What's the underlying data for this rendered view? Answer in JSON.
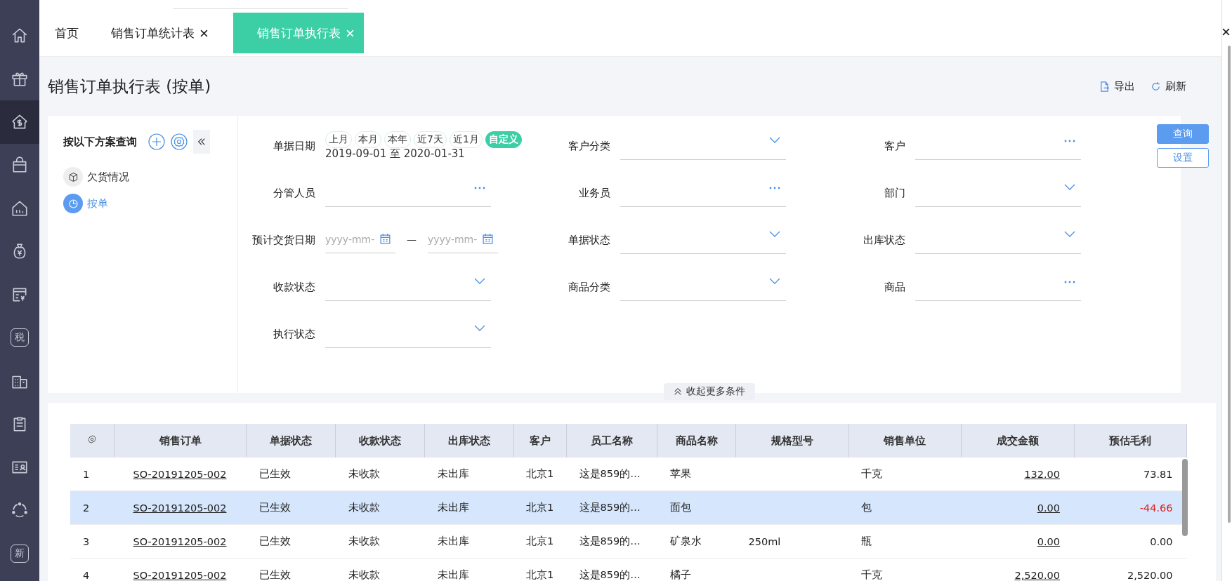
{
  "sidebar": {
    "items": [
      {
        "selected": false
      },
      {
        "selected": false
      },
      {
        "selected": true
      },
      {
        "selected": false
      },
      {
        "selected": false
      },
      {
        "selected": false
      },
      {
        "selected": false
      },
      {
        "glyph": "税",
        "selected": false
      },
      {
        "selected": false
      },
      {
        "selected": false
      },
      {
        "selected": false
      },
      {
        "selected": false
      },
      {
        "glyph": "新",
        "selected": false
      }
    ]
  },
  "tabs": [
    {
      "label": "首页",
      "closable": false,
      "selected": false
    },
    {
      "label": "销售订单统计表",
      "closable": true,
      "selected": false
    },
    {
      "label": "销售订单执行表",
      "closable": true,
      "selected": true
    }
  ],
  "page": {
    "title": "销售订单执行表 (按单)",
    "actions": [
      {
        "kind": "export",
        "label": "导出"
      },
      {
        "kind": "refresh",
        "label": "刷新"
      }
    ]
  },
  "schemes_panel": {
    "title": "按以下方案查询",
    "schemes": [
      {
        "label": "欠货情况",
        "selected": false
      },
      {
        "label": "按单",
        "selected": true
      }
    ]
  },
  "filters": [
    {
      "label": "单据日期",
      "kind": "date_presets",
      "presets": [
        {
          "label": "上月",
          "selected": false
        },
        {
          "label": "本月",
          "selected": false
        },
        {
          "label": "本年",
          "selected": false
        },
        {
          "label": "近7天",
          "selected": false
        },
        {
          "label": "近1月",
          "selected": false
        },
        {
          "label": "自定义",
          "selected": true
        }
      ],
      "range": "2019-09-01 至 2020-01-31"
    },
    {
      "label": "客户分类",
      "kind": "dropdown"
    },
    {
      "label": "客户",
      "kind": "picker"
    },
    {
      "label": "分管人员",
      "kind": "picker"
    },
    {
      "label": "业务员",
      "kind": "picker"
    },
    {
      "label": "部门",
      "kind": "dropdown"
    },
    {
      "label": "预计交货日期",
      "kind": "date_range",
      "from_placeholder": "yyyy-mm-",
      "separator": "—",
      "to_placeholder": "yyyy-mm-"
    },
    {
      "label": "单据状态",
      "kind": "dropdown"
    },
    {
      "label": "出库状态",
      "kind": "dropdown"
    },
    {
      "label": "收款状态",
      "kind": "dropdown"
    },
    {
      "label": "商品分类",
      "kind": "dropdown"
    },
    {
      "label": "商品",
      "kind": "picker"
    },
    {
      "label": "执行状态",
      "kind": "dropdown"
    }
  ],
  "buttons": [
    {
      "label": "查询",
      "kind": "primary"
    },
    {
      "label": "设置",
      "kind": "outline"
    }
  ],
  "collapse_label": "收起更多条件",
  "table": {
    "columns": [
      "销售订单",
      "单据状态",
      "收款状态",
      "出库状态",
      "客户",
      "员工名称",
      "商品名称",
      "规格型号",
      "销售单位",
      "成交金额",
      "预估毛利"
    ],
    "rows": [
      {
        "no": "1",
        "order": "SO-20191205-002",
        "doc_status": "已生效",
        "pay_status": "未收款",
        "out_status": "未出库",
        "customer": "北京1",
        "employee": "这是859的…",
        "product": "苹果",
        "unit": "千克",
        "amount": "132.00",
        "profit": "73.81",
        "loss": false,
        "selected": false
      },
      {
        "no": "2",
        "order": "SO-20191205-002",
        "doc_status": "已生效",
        "pay_status": "未收款",
        "out_status": "未出库",
        "customer": "北京1",
        "employee": "这是859的…",
        "product": "面包",
        "unit": "包",
        "amount": "0.00",
        "profit": "-44.66",
        "loss": true,
        "selected": true
      },
      {
        "no": "3",
        "order": "SO-20191205-002",
        "doc_status": "已生效",
        "pay_status": "未收款",
        "out_status": "未出库",
        "customer": "北京1",
        "employee": "这是859的…",
        "product": "矿泉水",
        "spec": "250ml",
        "unit": "瓶",
        "amount": "0.00",
        "profit": "0.00",
        "loss": false,
        "selected": false
      },
      {
        "no": "4",
        "order": "SO-20191205-002",
        "doc_status": "已生效",
        "pay_status": "未收款",
        "out_status": "未出库",
        "customer": "北京1",
        "employee": "这是859的…",
        "product": "橘子",
        "unit": "千克",
        "amount": "2,520.00",
        "profit": "2,520.00",
        "loss": false,
        "selected": false
      }
    ]
  }
}
